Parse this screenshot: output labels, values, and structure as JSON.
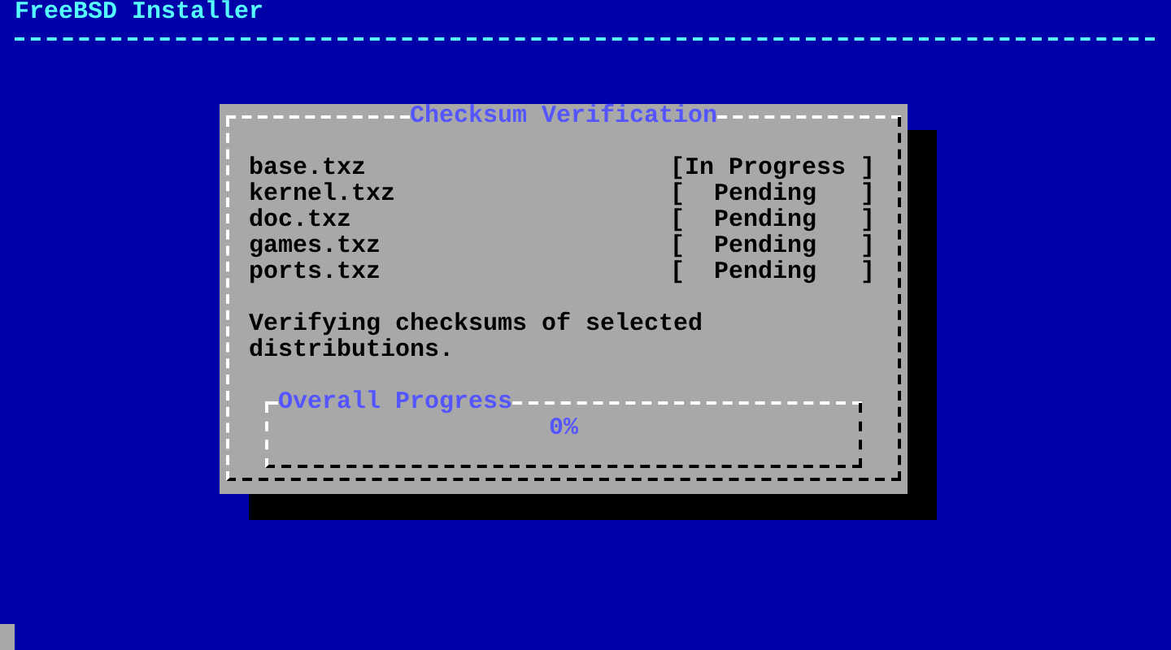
{
  "header": {
    "title": "FreeBSD Installer"
  },
  "dialog": {
    "title": "Checksum Verification",
    "files": [
      {
        "name": "base.txz",
        "status": "[In Progress ]"
      },
      {
        "name": "kernel.txz",
        "status": "[  Pending   ]"
      },
      {
        "name": "doc.txz",
        "status": "[  Pending   ]"
      },
      {
        "name": "games.txz",
        "status": "[  Pending   ]"
      },
      {
        "name": "ports.txz",
        "status": "[  Pending   ]"
      }
    ],
    "message": "Verifying checksums of selected distributions.",
    "progress": {
      "title": "Overall Progress",
      "level": 0,
      "reading": "0%"
    }
  }
}
